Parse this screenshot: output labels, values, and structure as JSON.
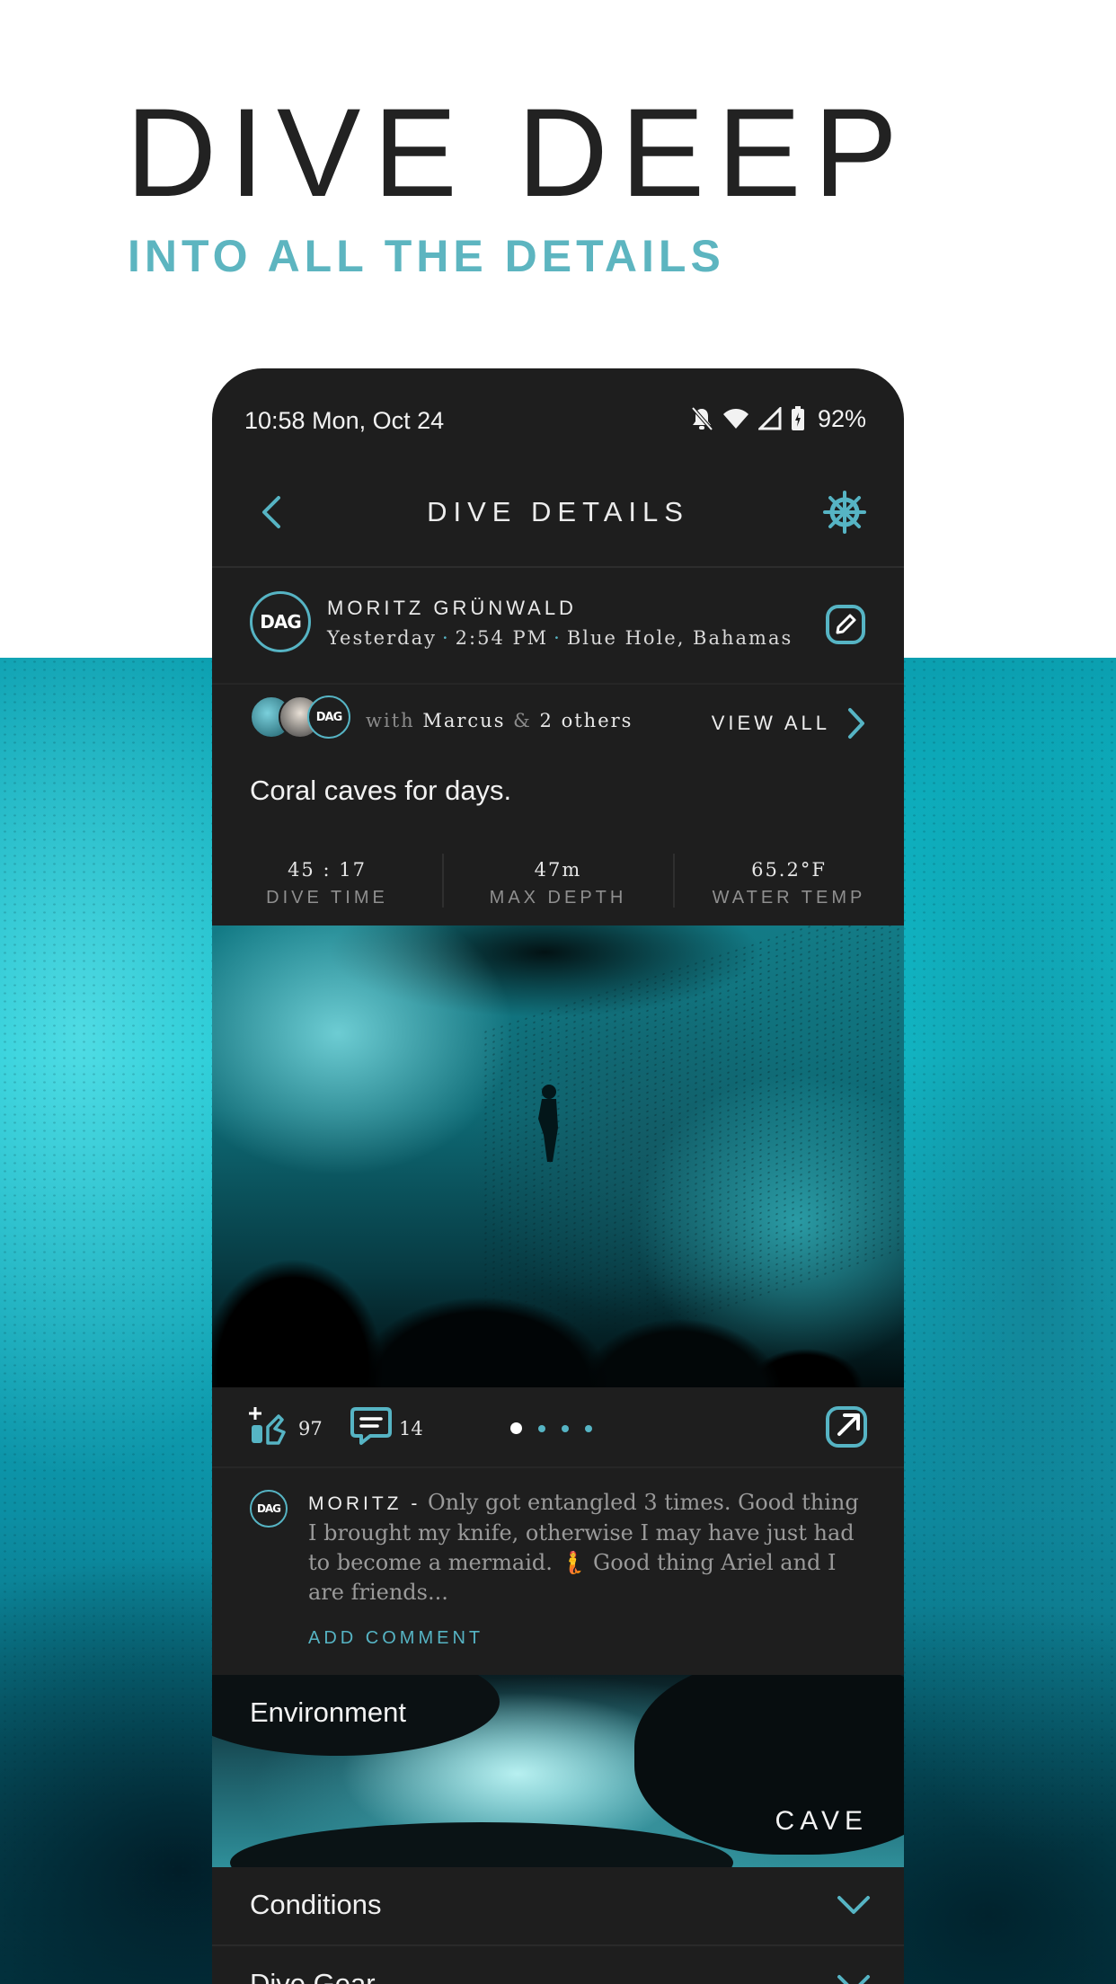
{
  "hero": {
    "title": "DIVE DEEP",
    "subtitle": "INTO ALL THE DETAILS"
  },
  "status_bar": {
    "time": "10:58  Mon, Oct 24",
    "battery": "92%"
  },
  "app_bar": {
    "title": "DIVE DETAILS"
  },
  "author": {
    "name": "MORITZ GRÜNWALD",
    "day": "Yesterday",
    "time": "2:54 PM",
    "location": "Blue Hole, Bahamas",
    "logo": "DAG"
  },
  "buddies": {
    "with_prefix": "with",
    "first_buddy": "Marcus",
    "amp": "&",
    "others": "2 others",
    "view_all": "VIEW ALL",
    "logo": "DAG"
  },
  "caption": "Coral caves for days.",
  "stats": [
    {
      "value": "45 : 17",
      "label": "DIVE TIME"
    },
    {
      "value": "47m",
      "label": "MAX DEPTH"
    },
    {
      "value": "65.2°F",
      "label": "WATER TEMP"
    }
  ],
  "actions": {
    "likes": "97",
    "comments": "14",
    "photo_count": 4,
    "active_photo": 1
  },
  "comment": {
    "author": "MORITZ -",
    "text": " Only got entangled 3 times. Good thing I brought my knife, otherwise I may have just had to become a mermaid. 🧜 Good thing Ariel and I are friends...",
    "add_comment": "ADD COMMENT",
    "logo": "DAG"
  },
  "environment": {
    "title": "Environment",
    "value": "CAVE"
  },
  "sections": {
    "conditions": "Conditions",
    "dive_gear": "Dive Gear"
  },
  "colors": {
    "accent": "#56b4c4",
    "background_dark": "#1e1e1e",
    "hero_sub": "#5db5c0"
  }
}
